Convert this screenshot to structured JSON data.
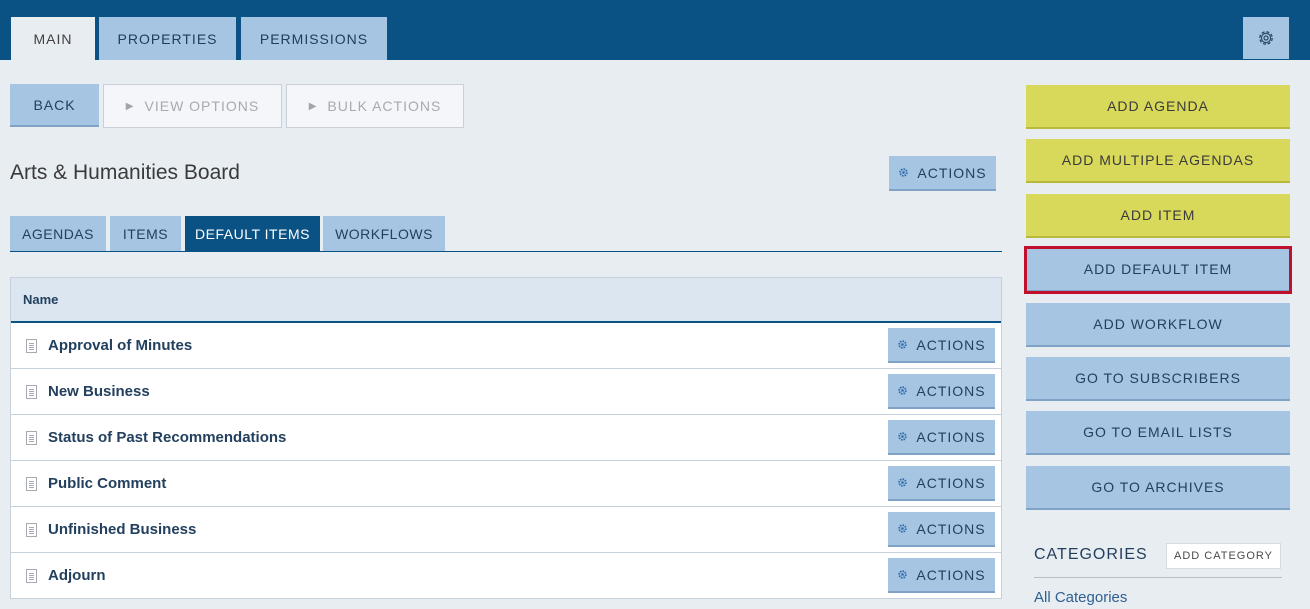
{
  "top_tabs": [
    {
      "label": "MAIN"
    },
    {
      "label": "PROPERTIES"
    },
    {
      "label": "PERMISSIONS"
    }
  ],
  "settings_icon": "gear-icon",
  "toolbar": {
    "back_label": "BACK",
    "view_options_label": "VIEW OPTIONS",
    "bulk_actions_label": "BULK ACTIONS"
  },
  "board": {
    "title": "Arts & Humanities Board",
    "actions_label": "ACTIONS"
  },
  "sub_tabs": [
    {
      "label": "AGENDAS"
    },
    {
      "label": "ITEMS"
    },
    {
      "label": "DEFAULT ITEMS"
    },
    {
      "label": "WORKFLOWS"
    }
  ],
  "table": {
    "column_name": "Name",
    "rows": [
      {
        "name": "Approval of Minutes",
        "actions": "ACTIONS"
      },
      {
        "name": "New Business",
        "actions": "ACTIONS"
      },
      {
        "name": "Status of Past Recommendations",
        "actions": "ACTIONS"
      },
      {
        "name": "Public Comment",
        "actions": "ACTIONS"
      },
      {
        "name": "Unfinished Business",
        "actions": "ACTIONS"
      },
      {
        "name": "Adjourn",
        "actions": "ACTIONS"
      }
    ]
  },
  "right_panel": {
    "buttons": [
      {
        "label": "ADD AGENDA"
      },
      {
        "label": "ADD MULTIPLE AGENDAS"
      },
      {
        "label": "ADD ITEM"
      },
      {
        "label": "ADD DEFAULT ITEM"
      },
      {
        "label": "ADD WORKFLOW"
      },
      {
        "label": "GO TO SUBSCRIBERS"
      },
      {
        "label": "GO TO EMAIL LISTS"
      },
      {
        "label": "GO TO ARCHIVES"
      }
    ],
    "categories_title": "CATEGORIES",
    "add_category_label": "ADD CATEGORY",
    "all_categories_label": "All Categories"
  },
  "colors": {
    "header_blue": "#0b5284",
    "light_blue": "#a6c5e2",
    "yellow": "#d8d95a",
    "selected_outline": "#c0102c"
  }
}
